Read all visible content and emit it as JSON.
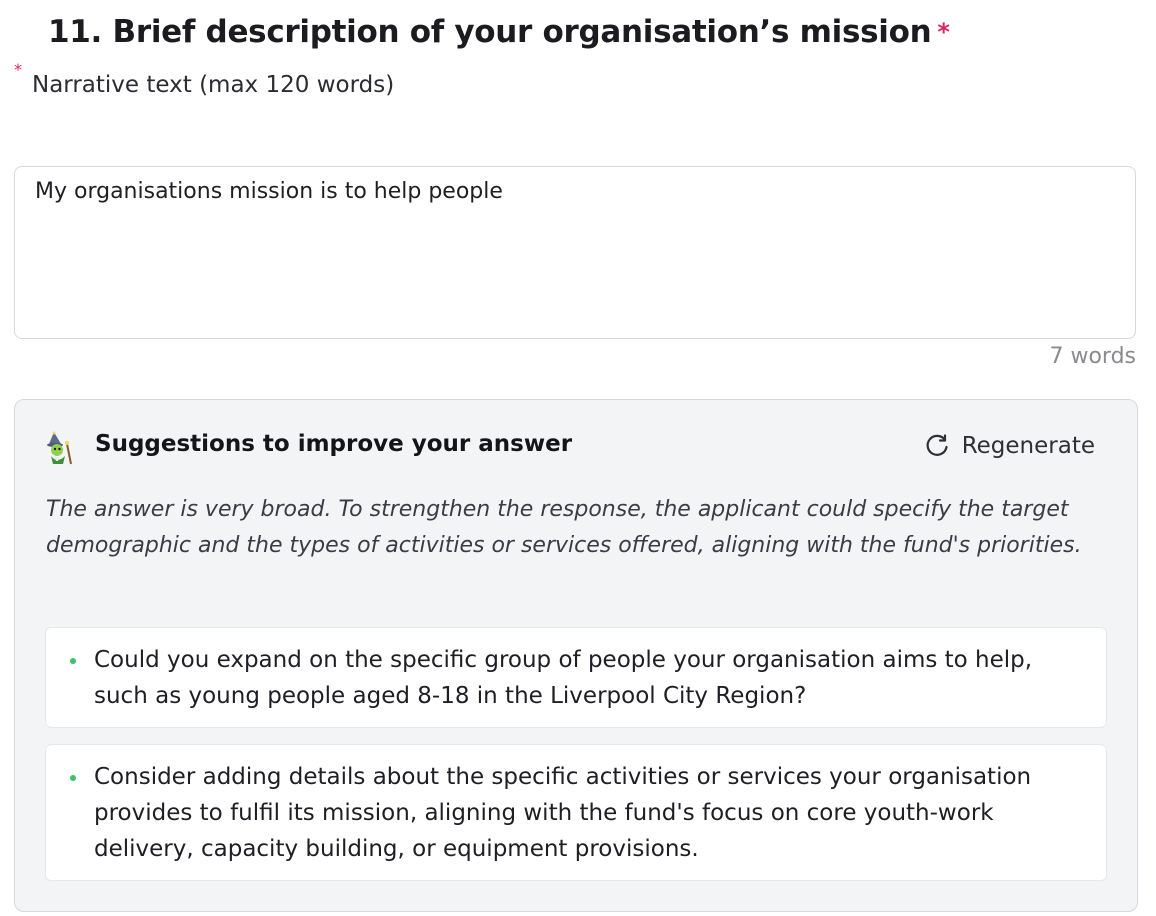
{
  "question": {
    "title": "11. Brief description of your organisation’s mission",
    "required_marker": "*",
    "hint_marker": "*",
    "hint": "Narrative text (max 120 words)"
  },
  "answer": {
    "value": "My organisations mission is to help people",
    "word_count": "7 words"
  },
  "suggestions": {
    "icon": "wizard-icon",
    "title": "Suggestions to improve your answer",
    "regenerate_icon": "refresh-icon",
    "regenerate_label": "Regenerate",
    "summary": "The answer is very broad. To strengthen the response, the applicant could specify the target demographic and the types of activities or services offered, aligning with the fund's priorities.",
    "items": [
      {
        "text": "Could you expand on the specific group of people your organisation aims to help, such as young people aged 8-18 in the Liverpool City Region?"
      },
      {
        "text": "Consider adding details about the specific activities or services your organisation provides to fulfil its mission, aligning with the fund's focus on core youth-work delivery, capacity building, or equipment provisions."
      }
    ]
  },
  "colors": {
    "required": "#e0245e",
    "bullet": "#36c46b",
    "panel_bg": "#f3f4f6",
    "border": "#d6d8dd"
  }
}
